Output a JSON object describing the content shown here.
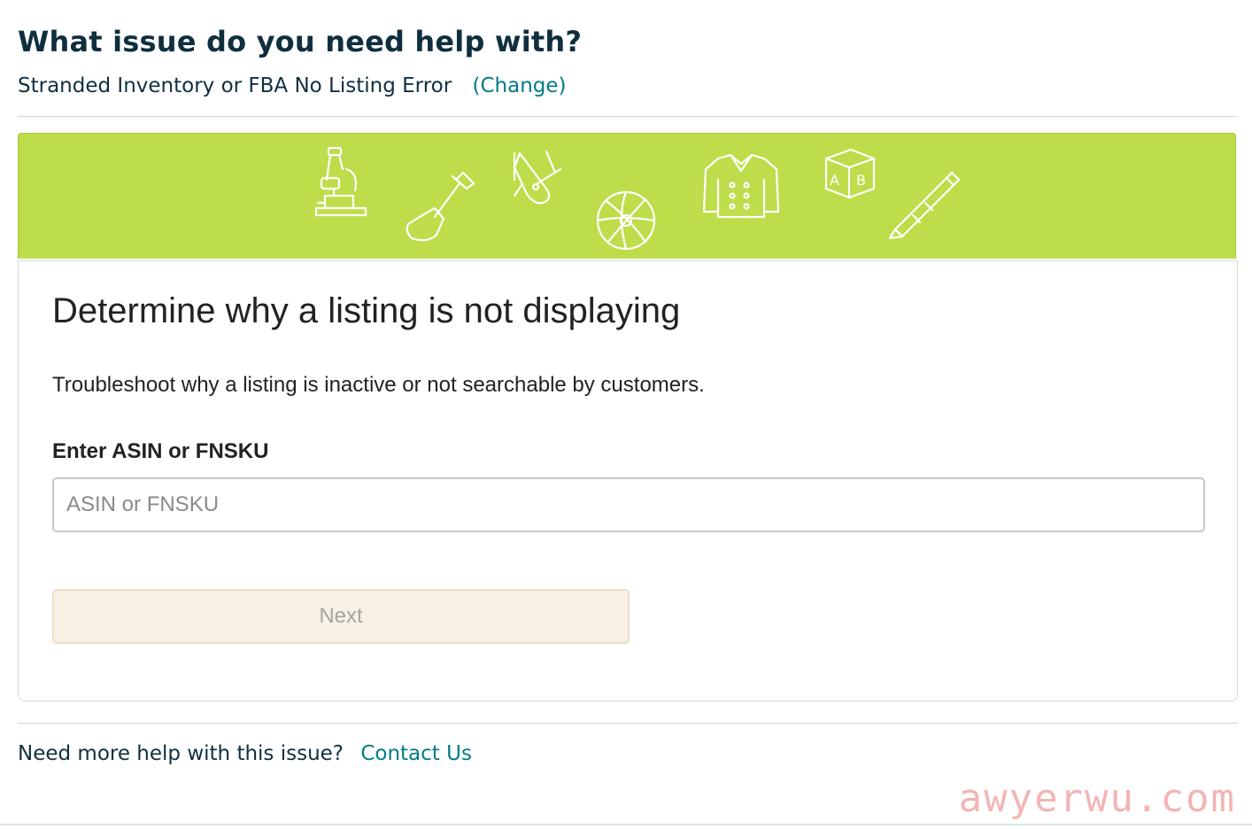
{
  "header": {
    "title": "What issue do you need help with?",
    "selected_issue": "Stranded Inventory or FBA No Listing Error",
    "change_link": "(Change)"
  },
  "banner": {
    "background_color": "#bedd4a",
    "icons": [
      "microscope-icon",
      "shovel-icon",
      "pocket-knife-icon",
      "beach-ball-icon",
      "jacket-icon",
      "toy-block-icon",
      "pen-icon"
    ]
  },
  "card": {
    "title": "Determine why a listing is not displaying",
    "description": "Troubleshoot why a listing is inactive or not searchable by customers.",
    "field_label": "Enter ASIN or FNSKU",
    "input_placeholder": "ASIN or FNSKU",
    "input_value": "",
    "next_label": "Next"
  },
  "footer": {
    "help_text": "Need more help with this issue?",
    "contact_link": "Contact Us"
  },
  "watermark": "awyerwu.com",
  "colors": {
    "link": "#007b85",
    "heading": "#0f2f3f",
    "banner": "#bedd4a",
    "next_disabled_bg": "#f8f1e3"
  }
}
